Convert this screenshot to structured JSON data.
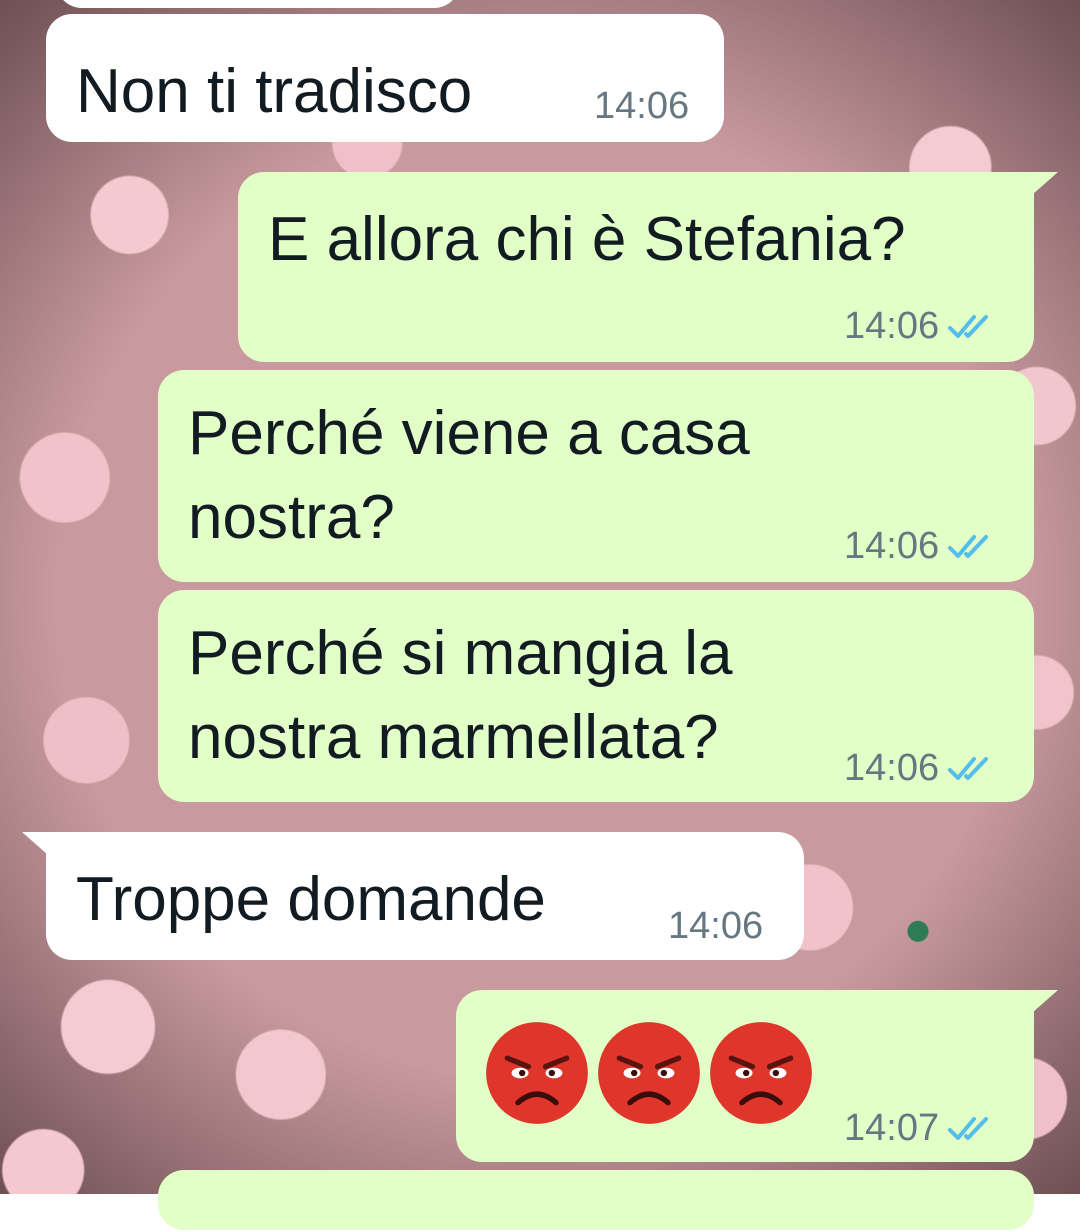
{
  "chat": {
    "messages": [
      {
        "direction": "in",
        "text": "Non ti tradisco",
        "time": "14:06"
      },
      {
        "direction": "out",
        "text": "E allora chi è Stefania?",
        "time": "14:06",
        "status": "read"
      },
      {
        "direction": "out",
        "text_line1": "Perché viene a casa",
        "text_line2": "nostra?",
        "time": "14:06",
        "status": "read"
      },
      {
        "direction": "out",
        "text_line1": "Perché si mangia la",
        "text_line2": "nostra marmellata?",
        "time": "14:06",
        "status": "read"
      },
      {
        "direction": "in",
        "text": "Troppe domande",
        "time": "14:06"
      },
      {
        "direction": "out",
        "emoji": [
          "angry-face",
          "angry-face",
          "angry-face"
        ],
        "time": "14:07",
        "status": "read"
      }
    ]
  },
  "colors": {
    "incoming_bubble": "#ffffff",
    "outgoing_bubble": "#e2ffc8",
    "read_ticks": "#53bdeb",
    "timestamp": "#667781"
  }
}
